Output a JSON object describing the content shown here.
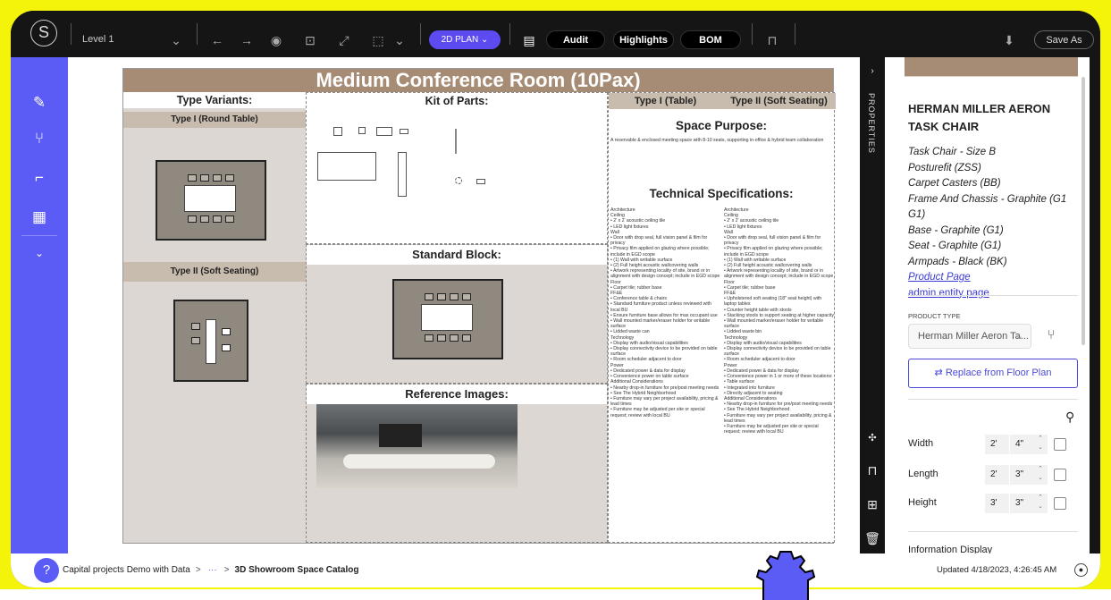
{
  "toolbar": {
    "logo": "S",
    "level": "Level 1",
    "view_mode": "2D PLAN",
    "audit": "Audit",
    "highlights": "Highlights",
    "bom": "BOM",
    "save_as": "Save As"
  },
  "board": {
    "title": "Medium Conference Room (10Pax)",
    "type_variants": "Type Variants:",
    "type_i": "Type I (Round Table)",
    "type_ii": "Type II (Soft Seating)",
    "kit_of_parts": "Kit of Parts:",
    "standard_block": "Standard Block:",
    "reference_images": "Reference Images:",
    "col_type_i": "Type I (Table)",
    "col_type_ii": "Type II (Soft Seating)",
    "space_purpose": "Space Purpose:",
    "space_purpose_text": "A reservable & enclosed meeting space with 8-10 seats, supporting in-office & hybrid team collaboration",
    "tech_specs": "Technical Specifications:",
    "spec_i": "Architecture\nCeiling\n• 2' x 2' acoustic ceiling tile\n• LED light fixtures\nWall\n• Door with drop seal, full vision panel & film for privacy\n• Privacy film applied on glazing where possible; include in EGD scope\n• (1) Wall with writable surface\n• (2) Full height acoustic wallcovering walls\n• Artwork representing locality of site, brand or in alignment with design concept; include in EGD scope\nFloor\n• Carpet tile; rubber base\nFF&E\n• Conference table & chairs\n• Standard furniture product unless reviewed with local BU\n• Ensure furniture base allows for max occupant use\n• Wall mounted marker/eraser holder for writable surface\n• Lidded waste can\nTechnology\n• Display with audio/visual capabilities\n• Display connectivity device to be provided on table surface\n• Room scheduler adjacent to door\nPower\n• Dedicated power & data for display\n• Convenience power on table surface\nAdditional Considerations\n• Nearby drop-in furniture for pre/post meeting needs\n• See The Hybrid Neighborhood\n• Furniture may vary per project availability, pricing & lead times\n• Furniture may be adjusted per site or special request; review with local BU",
    "spec_ii": "Architecture\nCeiling\n• 2' x 2' acoustic ceiling tile\n• LED light fixtures\nWall\n• Door with drop seal, full vision panel & film for privacy\n• Privacy film applied on glazing where possible; include in EGD scope\n• (1) Wall with writable surface\n• (2) Full height acoustic wallcovering walls\n• Artwork representing locality of site, brand or in alignment with design concept; include in EGD scope\nFloor\n• Carpet tile; rubber base\nFF&E\n• Upholstered soft seating (18\" seat height) with laptop tables\n• Counter height table with stools\n• Stacking stools to support seating at higher capacity\n• Wall mounted marker/eraser holder for writable surface\n• Lidded waste bin\nTechnology\n• Display with audio/visual capabilities\n• Display connectivity device to be provided on table surface\n• Room scheduler adjacent to door\nPower\n• Dedicated power & data for display\n• Convenience power in 1 or more of these locations:\n• Table surface\n• Integrated into furniture\n• Directly adjacent to seating\nAdditional Considerations\n• Nearby drop-in furniture for pre/post meeting needs\n• See The Hybrid Neighborhood\n• Furniture may vary per project availability, pricing & lead times\n• Furniture may be adjusted per site or special request; review with local BU"
  },
  "properties_rail": {
    "label": "PROPERTIES"
  },
  "panel": {
    "product_name": "HERMAN MILLER AERON TASK CHAIR",
    "attributes": [
      "Task Chair - Size B",
      "Posturefit (ZSS)",
      "Carpet Casters (BB)",
      "Frame And Chassis - Graphite (G1 G1)",
      "Base - Graphite (G1)",
      "Seat - Graphite (G1)",
      "Armpads - Black (BK)"
    ],
    "product_page_link": "Product Page",
    "admin_link": "admin entity page",
    "product_type_label": "PRODUCT TYPE",
    "product_type_value": "Herman Miller Aeron Ta...",
    "replace_button": "Replace from Floor Plan",
    "dimensions": [
      {
        "label": "Width",
        "feet": "2'",
        "inches": "4\""
      },
      {
        "label": "Length",
        "feet": "2'",
        "inches": "3\""
      },
      {
        "label": "Height",
        "feet": "3'",
        "inches": "3\""
      }
    ],
    "info_display": "Information Display"
  },
  "footer": {
    "help": "?",
    "crumb_root": "Capital projects Demo with Data",
    "crumb_more": "···",
    "crumb_current": "3D Showroom Space Catalog",
    "updated": "Updated 4/18/2023, 4:26:45 AM"
  },
  "colors": {
    "frame": "#f4f40a",
    "accent": "#5b5bf5",
    "board_header": "#a68c74",
    "link": "#3d3cd6"
  }
}
